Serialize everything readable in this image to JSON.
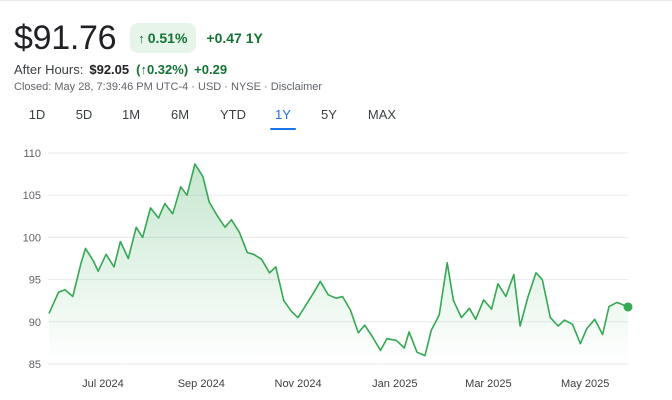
{
  "quote": {
    "price": "$91.76",
    "change_arrow": "↑",
    "change_pct": "0.51%",
    "change_abs": "+0.47",
    "period": "1Y",
    "after_hours_label": "After Hours:",
    "after_hours_price": "$92.05",
    "after_hours_pct": "(↑0.32%)",
    "after_hours_change": "+0.29",
    "closed_line": "Closed: May 28, 7:39:46 PM UTC-4 · USD · NYSE · Disclaimer"
  },
  "ranges": [
    "1D",
    "5D",
    "1M",
    "6M",
    "YTD",
    "1Y",
    "5Y",
    "MAX"
  ],
  "active_range": "1Y",
  "colors": {
    "up": "#137333",
    "up_bg": "#e6f4ea",
    "line": "#34a853",
    "active_tab": "#1a73e8",
    "grid": "#e8eaed"
  },
  "chart_data": {
    "type": "area",
    "title": "",
    "xlabel": "",
    "ylabel": "",
    "ylim": [
      85,
      110
    ],
    "yticks": [
      85,
      90,
      95,
      100,
      105,
      110
    ],
    "xlim": [
      "2024-05-28",
      "2025-05-28"
    ],
    "xticks": [
      {
        "date": "2024-07-01",
        "label": "Jul 2024"
      },
      {
        "date": "2024-09-01",
        "label": "Sep 2024"
      },
      {
        "date": "2024-11-01",
        "label": "Nov 2024"
      },
      {
        "date": "2025-01-01",
        "label": "Jan 2025"
      },
      {
        "date": "2025-03-01",
        "label": "Mar 2025"
      },
      {
        "date": "2025-05-01",
        "label": "May 2025"
      }
    ],
    "grid": true,
    "series": [
      {
        "x": [
          "2024-05-28",
          "2024-06-03",
          "2024-06-07",
          "2024-06-12",
          "2024-06-17",
          "2024-06-20",
          "2024-06-25",
          "2024-06-28",
          "2024-07-03",
          "2024-07-08",
          "2024-07-12",
          "2024-07-17",
          "2024-07-22",
          "2024-07-26",
          "2024-07-31",
          "2024-08-05",
          "2024-08-09",
          "2024-08-14",
          "2024-08-19",
          "2024-08-23",
          "2024-08-28",
          "2024-09-02",
          "2024-09-06",
          "2024-09-11",
          "2024-09-16",
          "2024-09-20",
          "2024-09-25",
          "2024-09-30",
          "2024-10-04",
          "2024-10-09",
          "2024-10-14",
          "2024-10-18",
          "2024-10-23",
          "2024-10-28",
          "2024-11-01",
          "2024-11-06",
          "2024-11-11",
          "2024-11-15",
          "2024-11-20",
          "2024-11-25",
          "2024-11-29",
          "2024-12-04",
          "2024-12-09",
          "2024-12-13",
          "2024-12-18",
          "2024-12-23",
          "2024-12-27",
          "2025-01-02",
          "2025-01-07",
          "2025-01-10",
          "2025-01-15",
          "2025-01-20",
          "2025-01-24",
          "2025-01-29",
          "2025-02-03",
          "2025-02-07",
          "2025-02-12",
          "2025-02-17",
          "2025-02-21",
          "2025-02-26",
          "2025-03-03",
          "2025-03-07",
          "2025-03-12",
          "2025-03-17",
          "2025-03-21",
          "2025-03-26",
          "2025-03-31",
          "2025-04-04",
          "2025-04-09",
          "2025-04-14",
          "2025-04-18",
          "2025-04-23",
          "2025-04-28",
          "2025-05-02",
          "2025-05-07",
          "2025-05-12",
          "2025-05-16",
          "2025-05-21",
          "2025-05-25",
          "2025-05-28"
        ],
        "values": [
          91.0,
          93.5,
          93.8,
          93.0,
          96.8,
          98.7,
          97.2,
          96.0,
          98.0,
          96.5,
          99.5,
          97.5,
          101.2,
          100.0,
          103.5,
          102.3,
          104.0,
          102.8,
          106.0,
          105.0,
          108.7,
          107.2,
          104.2,
          102.6,
          101.2,
          102.1,
          100.6,
          98.2,
          98.0,
          97.4,
          95.8,
          96.5,
          92.5,
          91.2,
          90.5,
          92.0,
          93.5,
          94.8,
          93.2,
          92.8,
          93.0,
          91.4,
          88.7,
          89.6,
          88.2,
          86.6,
          88.0,
          87.8,
          86.9,
          88.8,
          86.4,
          86.0,
          89.0,
          90.8,
          97.0,
          92.5,
          90.5,
          91.6,
          90.3,
          92.6,
          91.5,
          94.5,
          93.0,
          95.6,
          89.5,
          93.0,
          95.8,
          95.0,
          90.5,
          89.5,
          90.2,
          89.7,
          87.4,
          89.2,
          90.3,
          88.5,
          91.8,
          92.3,
          92.0,
          91.76
        ]
      }
    ],
    "last_point": {
      "date": "2025-05-28",
      "value": 91.76
    }
  }
}
